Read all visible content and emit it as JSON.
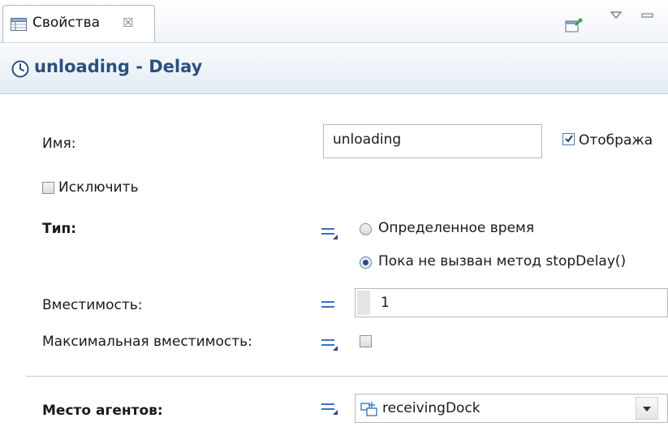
{
  "tab": {
    "title": "Свойства",
    "close_glyph": "☒",
    "icon": "properties-table-icon"
  },
  "toolbar": {
    "pin_icon": "pin-view-icon",
    "menu_icon": "view-menu-icon",
    "minimize_icon": "minimize-icon"
  },
  "header": {
    "title": "unloading - Delay",
    "icon": "clock-icon"
  },
  "fields": {
    "name_label": "Имя:",
    "name_value": "unloading",
    "show_label": "Отобража",
    "show_checked": true,
    "exclude_label": "Исключить",
    "exclude_checked": false,
    "type_label": "Тип:",
    "type_options": [
      "Определенное время",
      "Пока не вызван метод stopDelay()"
    ],
    "type_selected_index": 1,
    "capacity_label": "Вместимость:",
    "capacity_value": "1",
    "max_capacity_label": "Максимальная вместимость:",
    "max_capacity_checked": false,
    "agent_location_label": "Место агентов:",
    "agent_location_value": "receivingDock"
  },
  "colors": {
    "header_title": "#2b4f7e",
    "accent": "#2b4a80"
  }
}
